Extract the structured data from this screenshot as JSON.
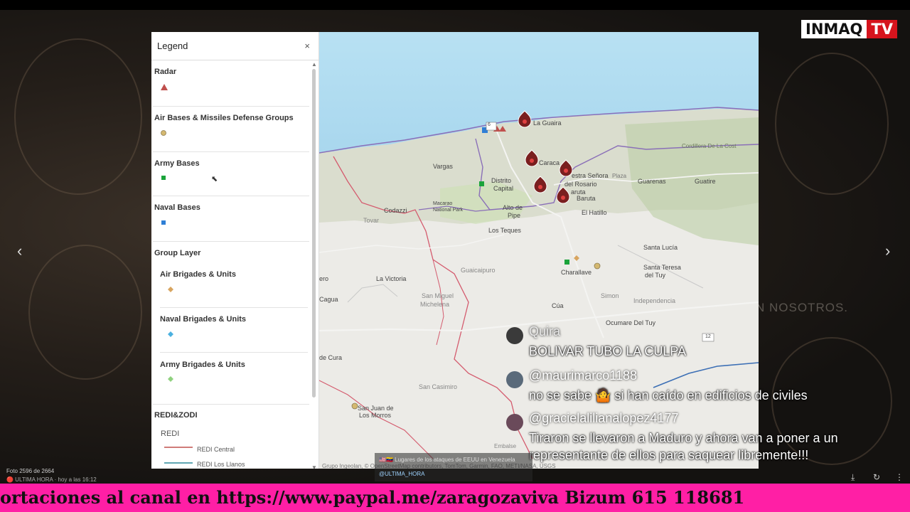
{
  "logo": {
    "part1": "INMAQ",
    "part2": "TV"
  },
  "background_text": "N NOSOTROS.",
  "legend": {
    "title": "Legend",
    "close": "×",
    "sections": [
      {
        "title": "Radar",
        "symbol": "triangle",
        "color": "#c0504d"
      },
      {
        "title": "Air Bases & Missiles Defense Groups",
        "symbol": "circle",
        "color": "#d4b870"
      },
      {
        "title": "Army Bases",
        "symbol": "square",
        "color": "#1aa33a"
      },
      {
        "title": "Naval Bases",
        "symbol": "square",
        "color": "#2f7fd6"
      }
    ],
    "group_layer": {
      "title": "Group Layer",
      "items": [
        {
          "title": "Air Brigades & Units",
          "symbol": "diamond",
          "color": "#d8a560"
        },
        {
          "title": "Naval Brigades & Units",
          "symbol": "diamond",
          "color": "#4bb1e0"
        },
        {
          "title": "Army Brigades & Units",
          "symbol": "diamond",
          "color": "#8fd17f"
        }
      ]
    },
    "redi": {
      "title": "REDI&ZODI",
      "sub": "REDI",
      "lines": [
        {
          "label": "REDI Central",
          "color": "#c0504d"
        },
        {
          "label": "REDI Los Llanos",
          "color": "#2b8a9a"
        }
      ]
    }
  },
  "map": {
    "labels": {
      "la_guaira": "La Guaira",
      "caracas": "Caraca",
      "senora": "estra Señora",
      "rosario": "del Rosario",
      "baruta1": "aruta",
      "baruta2": "Baruta",
      "vargas": "Vargas",
      "distrito": "Distrito",
      "capital": "Capital",
      "guarenas": "Guarenas",
      "guatire": "Guatire",
      "plaza": "Plaza",
      "el_hatillo": "El Hatillo",
      "alto_de": "Alto de",
      "pipe": "Pipe",
      "los_teques": "Los Teques",
      "codazzi": "Codazzi",
      "macarao": "Macarao",
      "national_park": "National Park",
      "tovar": "Tovar",
      "santa_lucia": "Santa Lucía",
      "santa_teresa": "Santa Teresa",
      "del_tuy": "del Tuy",
      "charallave": "Charallave",
      "guaicaipuro": "Guaicaipuro",
      "la_victoria": "La Victoria",
      "cagua": "Cagua",
      "san_miguel": "San Miguel",
      "michelena": "Michelena",
      "simon": "Simon",
      "independencia": "Independencia",
      "cua": "Cúa",
      "ocumare": "Ocumare Del Tuy",
      "san_casimiro": "San Casimiro",
      "de_cura": "de Cura",
      "san_juan": "San Juan de",
      "los_morros": "Los Morros",
      "cordillera": "Cordillera De La Cost",
      "embalse": "Embalse",
      "ero": "ero",
      "road_6": "6",
      "road_12": "12"
    },
    "attribution": "Grupo Ingeolan, © OpenStreetMap contributors, TomTom, Garmin, FAO, METI/NASA, USGS"
  },
  "chat": [
    {
      "user": "Quira",
      "text": "BOLIVAR TUBO LA CULPA"
    },
    {
      "user": "@maurimarco1188",
      "text": "no se sabe 🤷 si han caído en edificios de civiles"
    },
    {
      "user": "@gracielalilianalopez4177",
      "text": "Tiraron se llevaron a Maduro y ahora van a poner a un",
      "text2": "representante de ellos para saquear libremente!!!"
    }
  ],
  "caption": {
    "line1": "🇺🇸🇻🇪 Lugares de los ataques de EEUU en Venezuela",
    "line2": "@ULTIMA_HORA"
  },
  "photo_counter": "Foto 2596 de 2664",
  "channel_time": "🔴 ULTIMA HORA · hoy a las 16:12",
  "ticker": "ortaciones al canal en https://www.paypal.me/zaragozaviva Bizum 615 118681"
}
